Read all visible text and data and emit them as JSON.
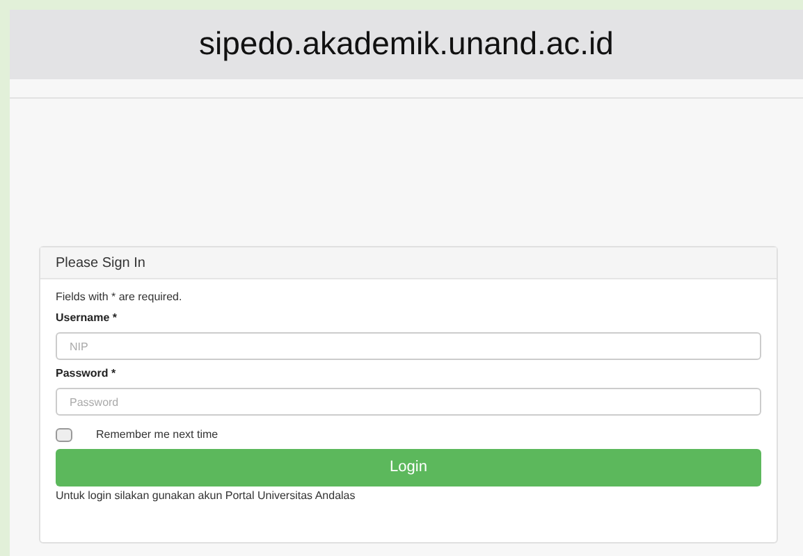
{
  "browser": {
    "address": "sipedo.akademik.unand.ac.id"
  },
  "panel": {
    "title": "Please Sign In",
    "note": "Fields with * are required.",
    "fields": [
      {
        "label": "Username *",
        "placeholder": "NIP"
      },
      {
        "label": "Password *",
        "placeholder": "Password"
      }
    ],
    "remember": {
      "label": "Remember me next time",
      "checked": false
    },
    "button": "Login",
    "footer": "Untuk login silakan gunakan akun Portal Universitas Andalas"
  }
}
